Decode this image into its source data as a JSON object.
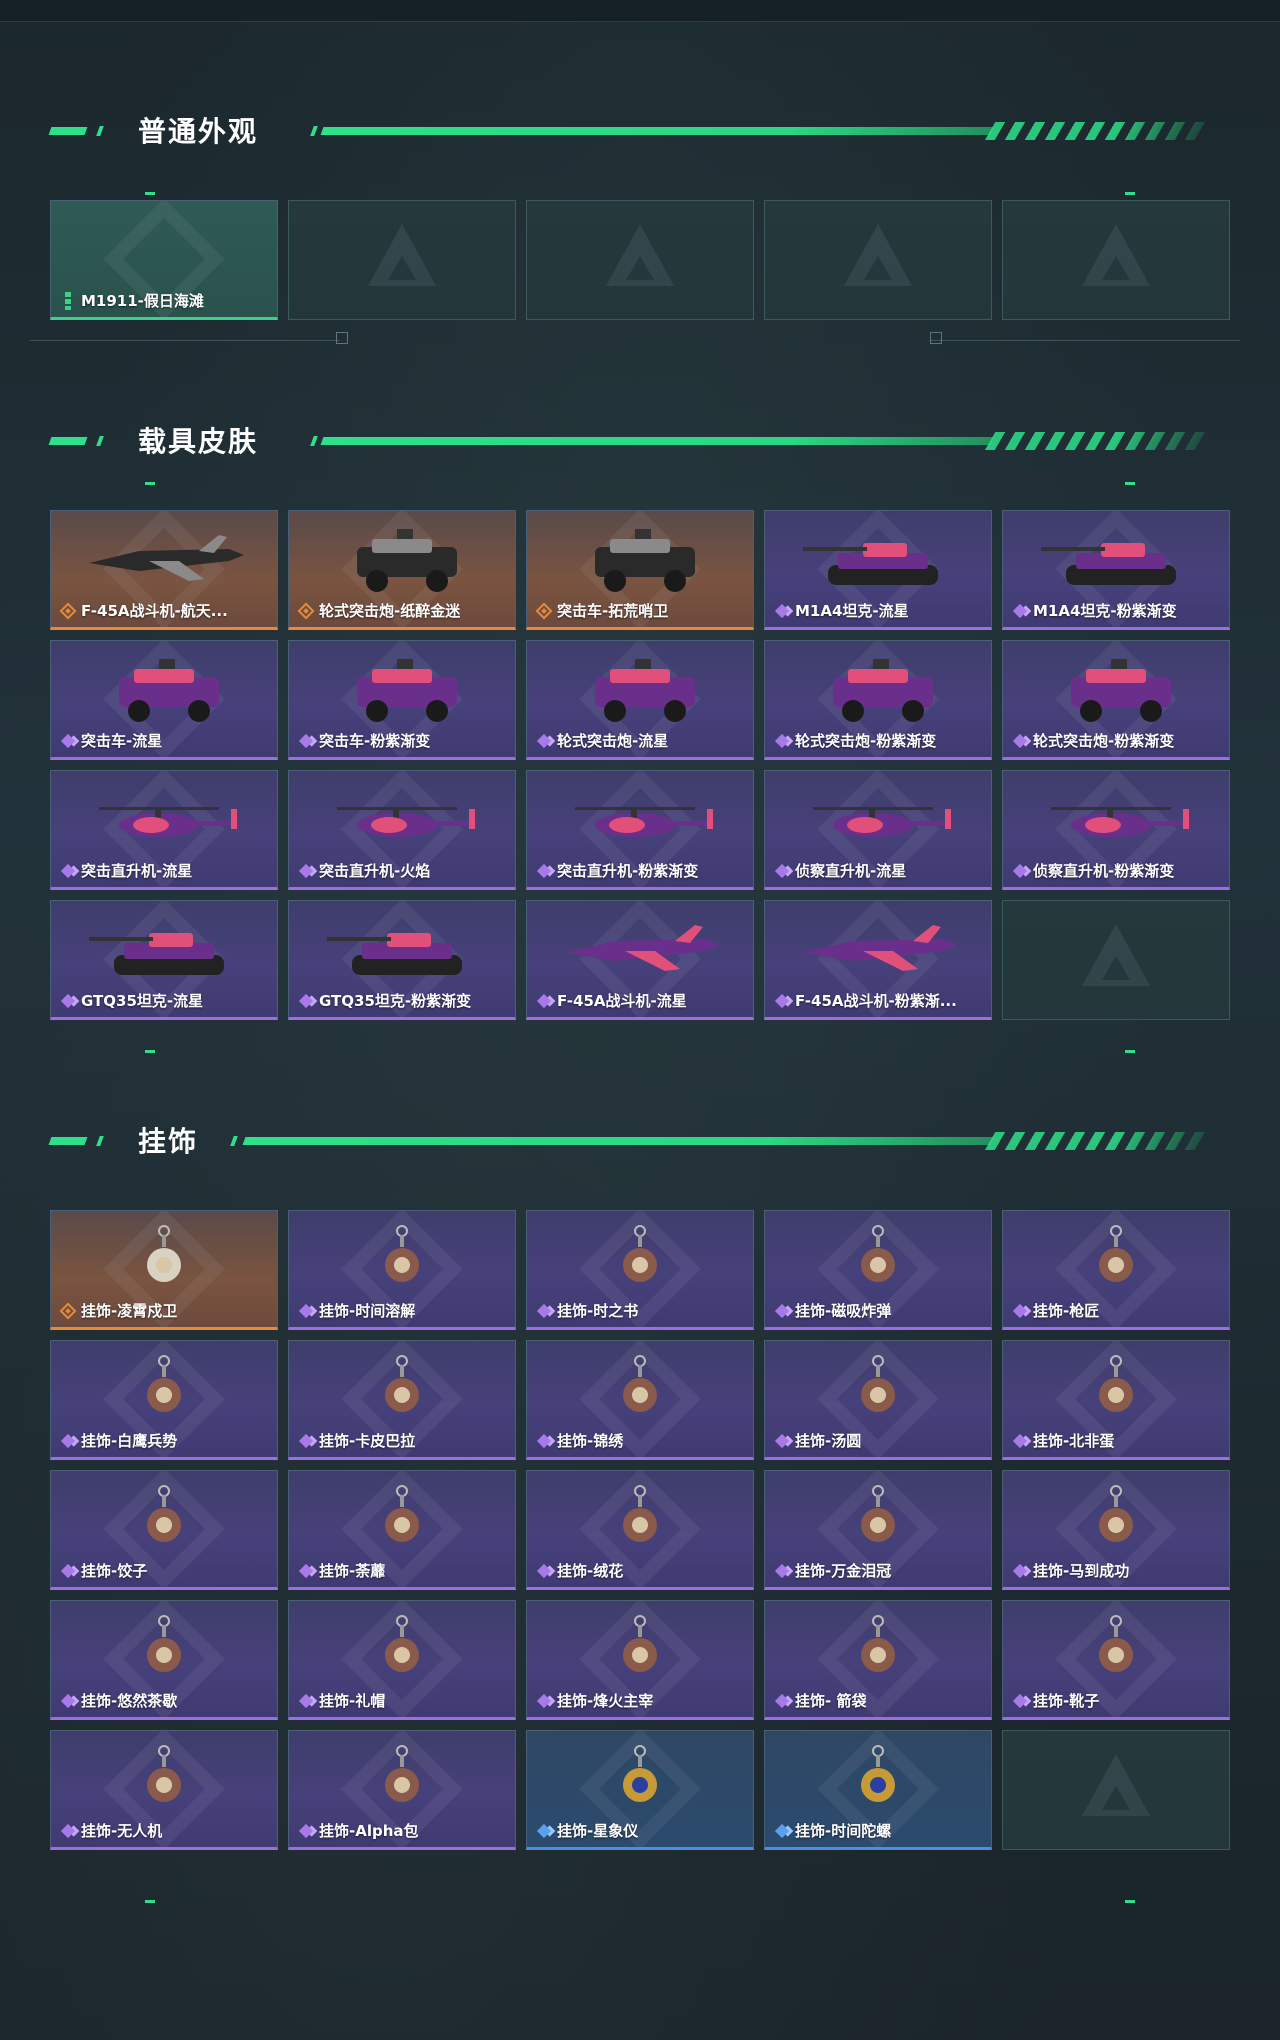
{
  "sections": {
    "normal": {
      "title": "普通外观",
      "items": [
        {
          "label": "M1911-假日海滩",
          "rarity": "green",
          "icon": "pistol-icon"
        },
        {
          "label": "",
          "rarity": "empty"
        },
        {
          "label": "",
          "rarity": "empty"
        },
        {
          "label": "",
          "rarity": "empty"
        },
        {
          "label": "",
          "rarity": "empty"
        }
      ]
    },
    "vehicles": {
      "title": "载具皮肤",
      "items": [
        {
          "label": "F-45A战斗机-航天...",
          "rarity": "orange",
          "icon": "fighter-jet-icon"
        },
        {
          "label": "轮式突击炮-纸醉金迷",
          "rarity": "orange",
          "icon": "armored-vehicle-icon"
        },
        {
          "label": "突击车-拓荒哨卫",
          "rarity": "orange",
          "icon": "assault-car-icon"
        },
        {
          "label": "M1A4坦克-流星",
          "rarity": "purple",
          "icon": "tank-icon"
        },
        {
          "label": "M1A4坦克-粉紫渐变",
          "rarity": "purple",
          "icon": "tank-icon"
        },
        {
          "label": "突击车-流星",
          "rarity": "purple",
          "icon": "assault-car-icon"
        },
        {
          "label": "突击车-粉紫渐变",
          "rarity": "purple",
          "icon": "assault-car-icon"
        },
        {
          "label": "轮式突击炮-流星",
          "rarity": "purple",
          "icon": "armored-vehicle-icon"
        },
        {
          "label": "轮式突击炮-粉紫渐变",
          "rarity": "purple",
          "icon": "armored-vehicle-icon"
        },
        {
          "label": "轮式突击炮-粉紫渐变",
          "rarity": "purple",
          "icon": "armored-vehicle-icon"
        },
        {
          "label": "突击直升机-流星",
          "rarity": "purple",
          "icon": "attack-helicopter-icon"
        },
        {
          "label": "突击直升机-火焰",
          "rarity": "purple",
          "icon": "attack-helicopter-icon"
        },
        {
          "label": "突击直升机-粉紫渐变",
          "rarity": "purple",
          "icon": "attack-helicopter-icon"
        },
        {
          "label": "侦察直升机-流星",
          "rarity": "purple",
          "icon": "scout-helicopter-icon"
        },
        {
          "label": "侦察直升机-粉紫渐变",
          "rarity": "purple",
          "icon": "scout-helicopter-icon"
        },
        {
          "label": "GTQ35坦克-流星",
          "rarity": "purple",
          "icon": "tank-icon"
        },
        {
          "label": "GTQ35坦克-粉紫渐变",
          "rarity": "purple",
          "icon": "tank-icon"
        },
        {
          "label": "F-45A战斗机-流星",
          "rarity": "purple",
          "icon": "fighter-jet-icon"
        },
        {
          "label": "F-45A战斗机-粉紫渐...",
          "rarity": "purple",
          "icon": "fighter-jet-icon"
        },
        {
          "label": "",
          "rarity": "empty"
        }
      ]
    },
    "charms": {
      "title": "挂饰",
      "items": [
        {
          "label": "挂饰-凌霄戍卫",
          "rarity": "orange",
          "icon": "charm-icon"
        },
        {
          "label": "挂饰-时间溶解",
          "rarity": "purple",
          "icon": "charm-icon"
        },
        {
          "label": "挂饰-时之书",
          "rarity": "purple",
          "icon": "charm-icon"
        },
        {
          "label": "挂饰-磁吸炸弹",
          "rarity": "purple",
          "icon": "charm-icon"
        },
        {
          "label": "挂饰-枪匠",
          "rarity": "purple",
          "icon": "charm-icon"
        },
        {
          "label": "挂饰-白鹰兵势",
          "rarity": "purple",
          "icon": "charm-icon"
        },
        {
          "label": "挂饰-卡皮巴拉",
          "rarity": "purple",
          "icon": "charm-icon"
        },
        {
          "label": "挂饰-锦绣",
          "rarity": "purple",
          "icon": "charm-icon"
        },
        {
          "label": "挂饰-汤圆",
          "rarity": "purple",
          "icon": "charm-icon"
        },
        {
          "label": "挂饰-北非蛋",
          "rarity": "purple",
          "icon": "charm-icon"
        },
        {
          "label": "挂饰-饺子",
          "rarity": "purple",
          "icon": "charm-icon"
        },
        {
          "label": "挂饰-荼蘼",
          "rarity": "purple",
          "icon": "charm-icon"
        },
        {
          "label": "挂饰-绒花",
          "rarity": "purple",
          "icon": "charm-icon"
        },
        {
          "label": "挂饰-万金泪冠",
          "rarity": "purple",
          "icon": "charm-icon"
        },
        {
          "label": "挂饰-马到成功",
          "rarity": "purple",
          "icon": "charm-icon"
        },
        {
          "label": "挂饰-悠然茶歇",
          "rarity": "purple",
          "icon": "charm-icon"
        },
        {
          "label": "挂饰-礼帽",
          "rarity": "purple",
          "icon": "charm-icon"
        },
        {
          "label": "挂饰-烽火主宰",
          "rarity": "purple",
          "icon": "charm-icon"
        },
        {
          "label": "挂饰- 箭袋",
          "rarity": "purple",
          "icon": "charm-icon"
        },
        {
          "label": "挂饰-靴子",
          "rarity": "purple",
          "icon": "charm-icon"
        },
        {
          "label": "挂饰-无人机",
          "rarity": "purple",
          "icon": "charm-icon"
        },
        {
          "label": "挂饰-Alpha包",
          "rarity": "purple",
          "icon": "charm-icon"
        },
        {
          "label": "挂饰-星象仪",
          "rarity": "blue",
          "icon": "charm-icon"
        },
        {
          "label": "挂饰-时间陀螺",
          "rarity": "blue",
          "icon": "charm-icon"
        },
        {
          "label": "",
          "rarity": "empty"
        }
      ]
    }
  },
  "colors": {
    "accent": "#2ee08a",
    "purple": "#9b6fe0",
    "orange": "#e58a3a",
    "green": "#3dd08a",
    "blue": "#4b8fe0"
  }
}
